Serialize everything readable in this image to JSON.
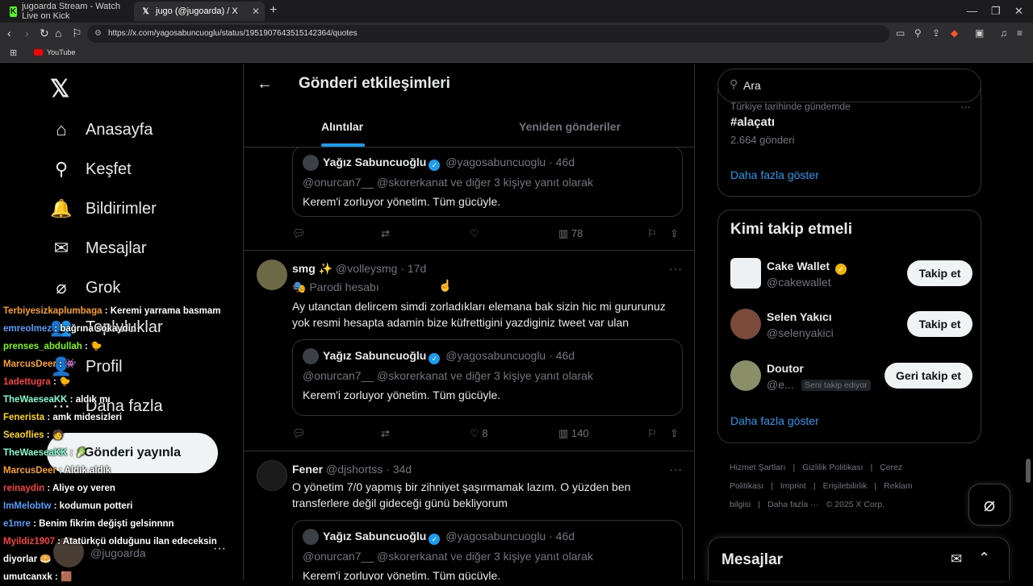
{
  "browser": {
    "tabs": [
      {
        "title": "jugoarda Stream - Watch Live on Kick",
        "favicon": "K"
      },
      {
        "title": "jugo (@jugoarda) / X",
        "favicon": "X"
      }
    ],
    "new_tab": "+",
    "url": "https://x.com/yagosabuncuoglu/status/1951907643515142364/quotes",
    "bookmark": "YouTube"
  },
  "sidebar": {
    "items": [
      {
        "label": "Anasayfa",
        "icon": "⌂"
      },
      {
        "label": "Keşfet",
        "icon": "⚲"
      },
      {
        "label": "Bildirimler",
        "icon": "🔔"
      },
      {
        "label": "Mesajlar",
        "icon": "✉"
      },
      {
        "label": "Grok",
        "icon": "⌀"
      },
      {
        "label": "Topluluklar",
        "icon": "👥"
      },
      {
        "label": "Profil",
        "icon": "👤"
      },
      {
        "label": "Daha fazla",
        "icon": "⋯"
      }
    ],
    "post_button": "Gönderi yayınla",
    "account_handle": "@jugoarda"
  },
  "main": {
    "title": "Gönderi etkileşimleri",
    "tabs": [
      "Alıntılar",
      "Yeniden gönderiler"
    ],
    "quoted": {
      "name": "Yağız Sabuncuoğlu",
      "handle": "@yagosabuncuoglu · 46d",
      "reply_to": "@onurcan7__ @skorerkanat  ve diğer 3 kişiye yanıt olarak",
      "text": "Kerem'i zorluyor yönetim. Tüm gücüyle."
    },
    "tweets": [
      {
        "views": "78"
      },
      {
        "name": "smg ✨",
        "handle": "@volleysmg · 17d",
        "parody": "Parodi hesabı",
        "text": "Ay utanctan delircem simdi zorladıkları elemana bak sizin hic mi gururunuz yok resmi hesapta adamin bize küfrettigini yazdiginiz tweet var ulan",
        "likes": "8",
        "views": "140"
      },
      {
        "name": "Fener",
        "handle": "@djshortss · 34d",
        "text": "O yönetim 7/0 yapmış bir zihniyet şaşırmamak lazım.  O yüzden ben transferlere değil gideceği günü bekliyorum"
      }
    ]
  },
  "chat": [
    {
      "user": "Terbiyesizkaplumbaga",
      "msg": ": Keremi yarrama basmam",
      "color": "#ff9f1c"
    },
    {
      "user": "emreolmez",
      "msg": ": bağrına sokaydın",
      "color": "#4d9fff"
    },
    {
      "user": "prenses_abdullah",
      "msg": ": 🐤",
      "color": "#7cfc00"
    },
    {
      "user": "MarcusDeer",
      "msg": ": 👾",
      "color": "#ff9f1c"
    },
    {
      "user": "1adettugra",
      "msg": ": 🐤",
      "color": "#ff3b3b"
    },
    {
      "user": "TheWaeseaKK",
      "msg": ": aldık mı",
      "color": "#7fffd4"
    },
    {
      "user": "Fenerista",
      "msg": ": amk midesizleri",
      "color": "#ffd700"
    },
    {
      "user": "Seaoflies",
      "msg": ": 🧑",
      "color": "#ffd700"
    },
    {
      "user": "TheWaeseaKK",
      "msg": ": 🥬",
      "color": "#7fffd4"
    },
    {
      "user": "MarcusDeer",
      "msg": ": Aldık aldık",
      "color": "#ff9f1c"
    },
    {
      "user": "reinaydin",
      "msg": ": Aliye oy veren",
      "color": "#ff3b3b"
    },
    {
      "user": "ImMelobtw",
      "msg": ": kodumun potteri",
      "color": "#4d9fff"
    },
    {
      "user": "e1mre",
      "msg": ": Benim fikrim değişti gelsinnnn",
      "color": "#4d9fff"
    },
    {
      "user": "Myildiz1907",
      "msg": ": Atatürkçü olduğunu ilan edeceksin",
      "color": "#ff3b3b"
    },
    {
      "user": "diyorlar",
      "msg": "🥯",
      "color": "#ffffff"
    },
    {
      "user": "umutcanxk",
      "msg": ": 🟫",
      "color": "#ffffff"
    }
  ],
  "right": {
    "search_placeholder": "Ara",
    "trend_context": "Türkiye tarihinde gündemde",
    "trend_tag": "#alaçatı",
    "trend_count": "2.664 gönderi",
    "show_more": "Daha fazla göster",
    "who_title": "Kimi takip etmeli",
    "suggestions": [
      {
        "name": "Cake Wallet",
        "handle": "@cakewallet",
        "button": "Takip et"
      },
      {
        "name": "Selen Yakıcı",
        "handle": "@selenyakici",
        "button": "Takip et"
      },
      {
        "name": "Doutor",
        "handle": "@e...",
        "badge": "Seni takip ediyor",
        "button": "Geri takip et"
      }
    ],
    "show_more_2": "Daha fazla göster",
    "footer": [
      "Hizmet Şartları",
      "|",
      "Gizlilik Politikası",
      "|",
      "Çerez Politikası",
      "|",
      "Imprint",
      "|",
      "Erişilebilirlik",
      "|",
      "Reklam bilgisi",
      "|",
      "Daha fazla ···",
      "© 2025 X Corp."
    ],
    "messages_title": "Mesajlar"
  }
}
